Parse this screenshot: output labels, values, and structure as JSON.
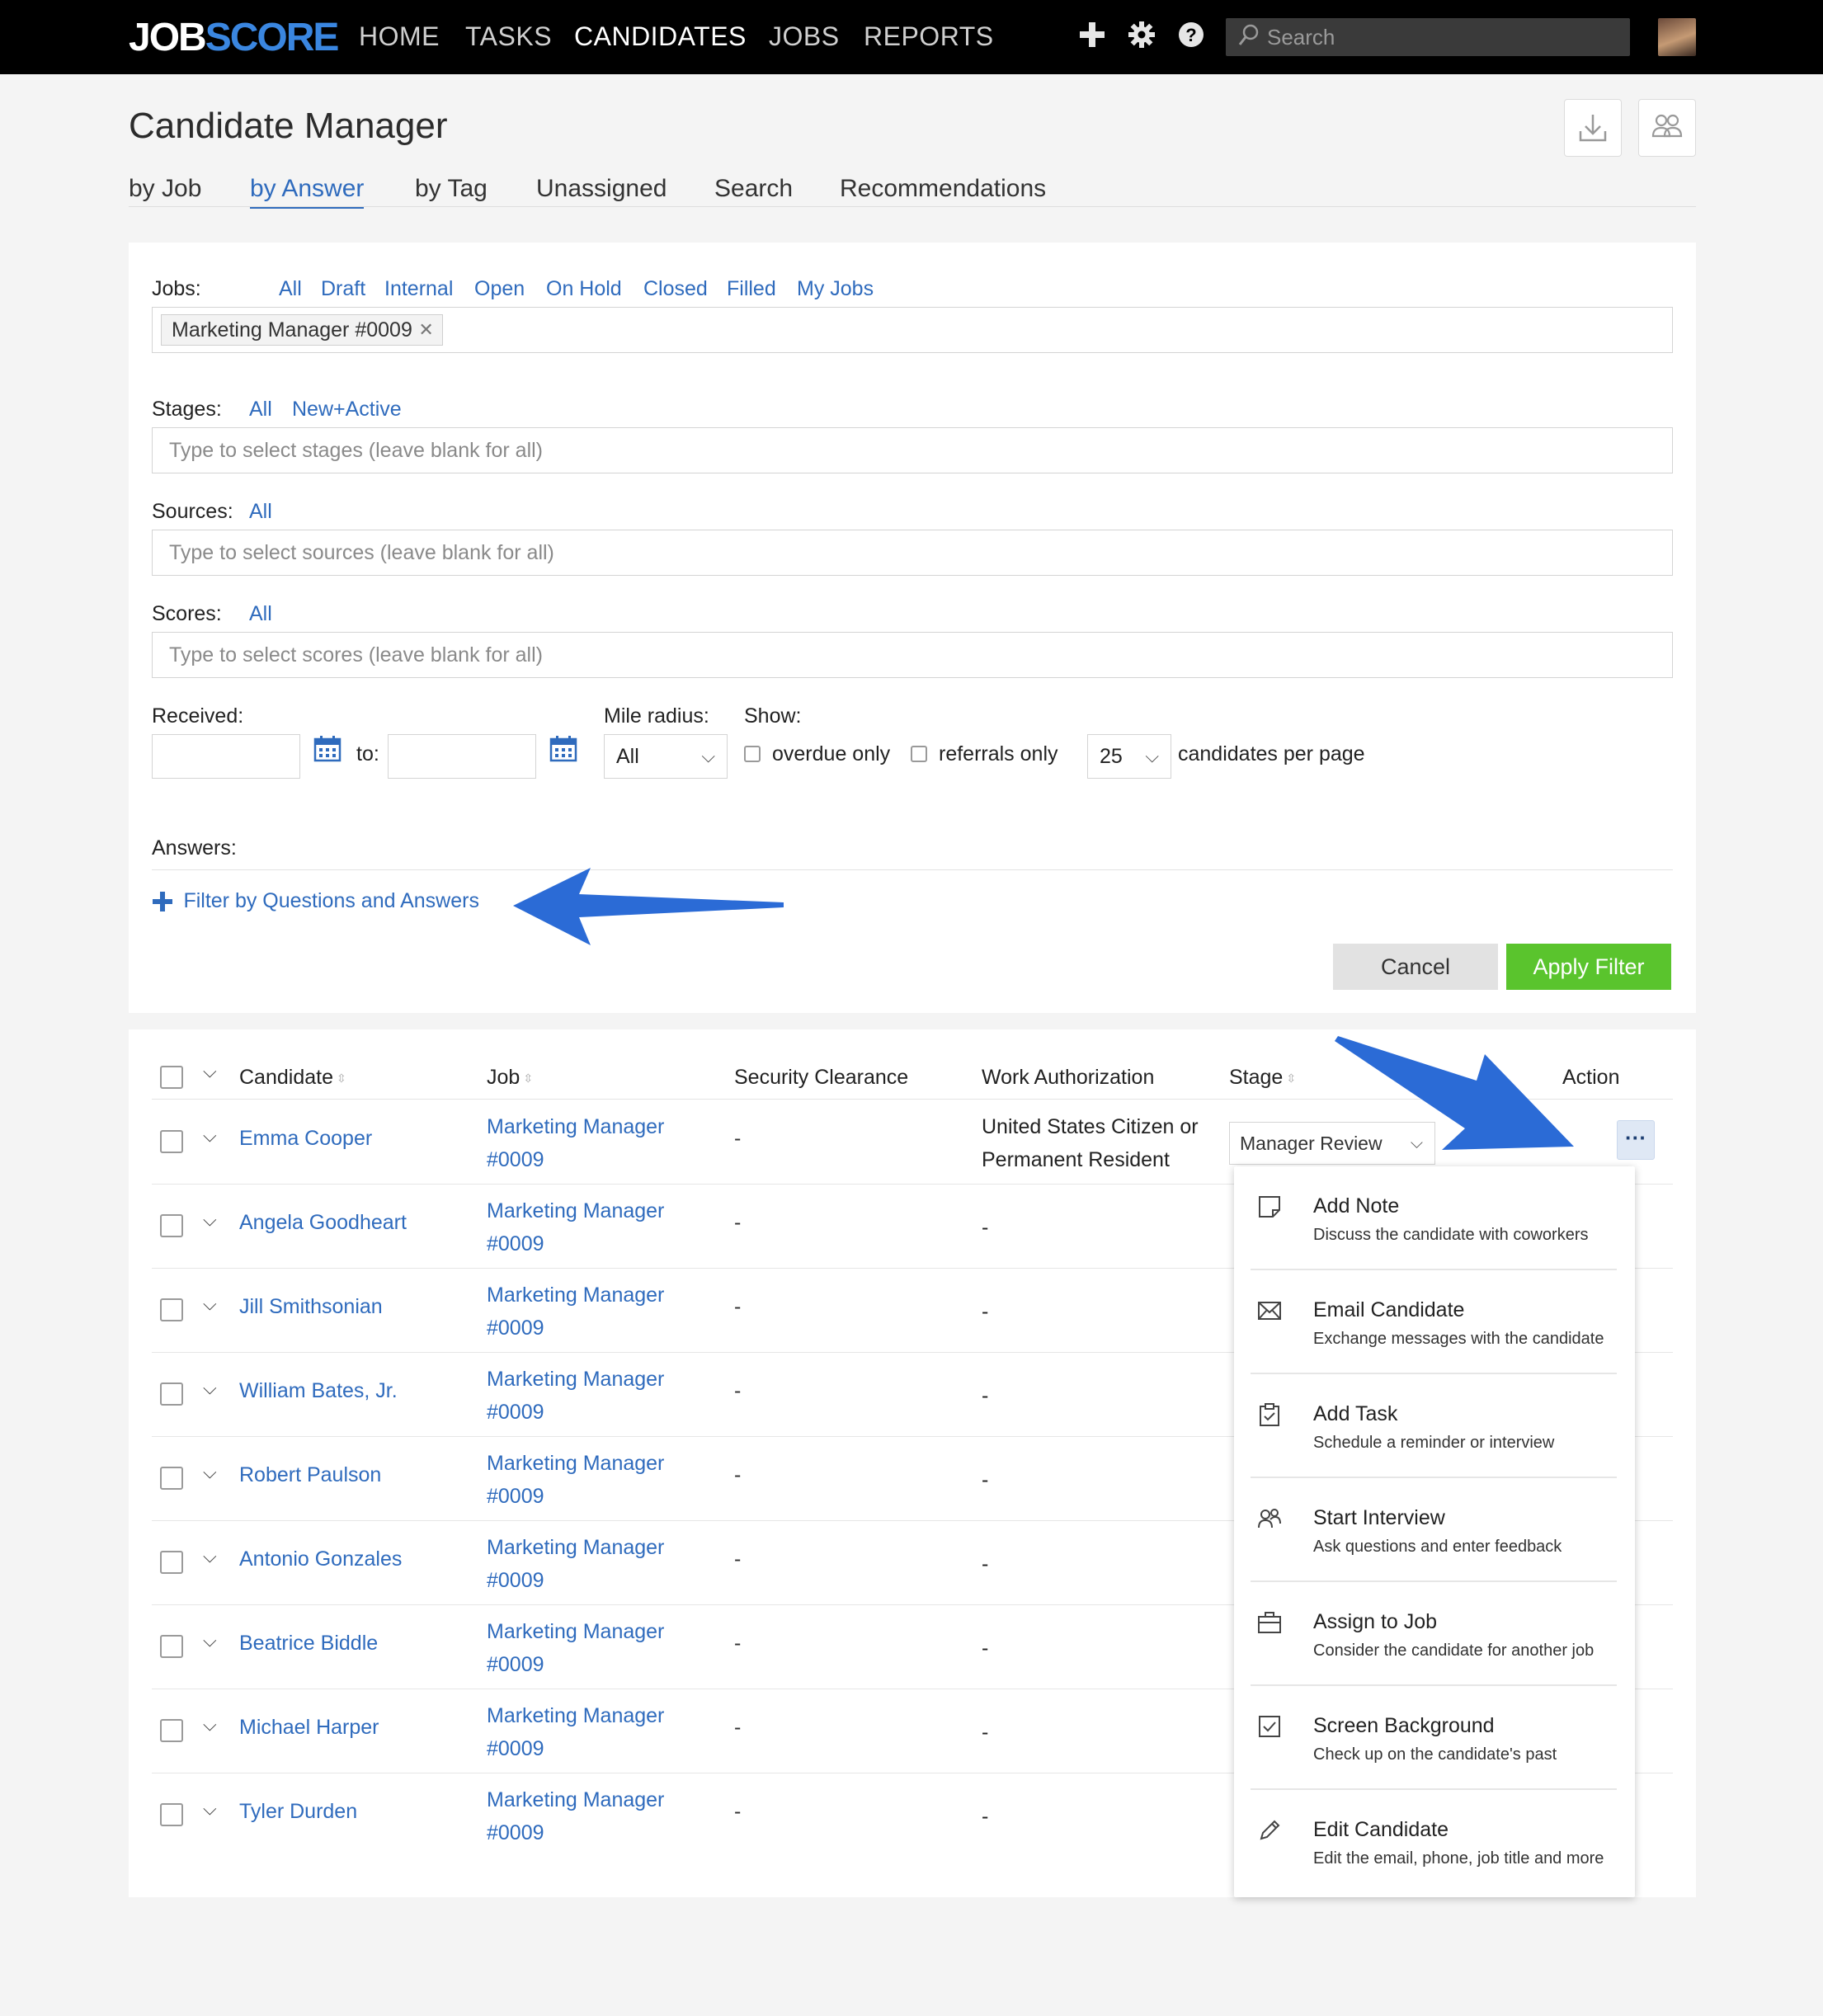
{
  "topnav": {
    "logo_part1": "JOB",
    "logo_part2": "SCORE",
    "links": [
      "HOME",
      "TASKS",
      "CANDIDATES",
      "JOBS",
      "REPORTS"
    ],
    "active": "CANDIDATES",
    "search_placeholder": "Search"
  },
  "header": {
    "title": "Candidate Manager",
    "tabs": [
      "by Job",
      "by Answer",
      "by Tag",
      "Unassigned",
      "Search",
      "Recommendations"
    ],
    "active_tab": "by Answer"
  },
  "filters": {
    "jobs_label": "Jobs:",
    "jobs_links": [
      "All",
      "Draft",
      "Internal",
      "Open",
      "On Hold",
      "Closed",
      "Filled",
      "My Jobs"
    ],
    "selected_job": "Marketing Manager #0009",
    "stages_label": "Stages:",
    "stages_links": [
      "All",
      "New+Active"
    ],
    "stages_placeholder": "Type to select stages (leave blank for all)",
    "sources_label": "Sources:",
    "sources_links": [
      "All"
    ],
    "sources_placeholder": "Type to select sources (leave blank for all)",
    "scores_label": "Scores:",
    "scores_links": [
      "All"
    ],
    "scores_placeholder": "Type to select scores (leave blank for all)",
    "received_label": "Received:",
    "to_label": "to:",
    "radius_label": "Mile radius:",
    "radius_value": "All",
    "show_label": "Show:",
    "overdue_label": "overdue only",
    "referrals_label": "referrals only",
    "per_page_value": "25",
    "per_page_label": "candidates per page",
    "answers_label": "Answers:",
    "filter_qa_label": "Filter by Questions and Answers",
    "cancel_label": "Cancel",
    "apply_label": "Apply Filter"
  },
  "table": {
    "headers": {
      "candidate": "Candidate",
      "job": "Job",
      "security": "Security Clearance",
      "work_auth": "Work Authorization",
      "stage": "Stage",
      "action": "Action"
    },
    "rows": [
      {
        "name": "Emma Cooper",
        "job1": "Marketing Manager",
        "job2": "#0009",
        "security": "-",
        "auth1": "United States Citizen or",
        "auth2": "Permanent Resident",
        "stage": "Manager Review"
      },
      {
        "name": "Angela Goodheart",
        "job1": "Marketing Manager",
        "job2": "#0009",
        "security": "-",
        "auth1": "-",
        "auth2": ""
      },
      {
        "name": "Jill Smithsonian",
        "job1": "Marketing Manager",
        "job2": "#0009",
        "security": "-",
        "auth1": "-",
        "auth2": ""
      },
      {
        "name": "William Bates, Jr.",
        "job1": "Marketing Manager",
        "job2": "#0009",
        "security": "-",
        "auth1": "-",
        "auth2": ""
      },
      {
        "name": "Robert Paulson",
        "job1": "Marketing Manager",
        "job2": "#0009",
        "security": "-",
        "auth1": "-",
        "auth2": ""
      },
      {
        "name": "Antonio Gonzales",
        "job1": "Marketing Manager",
        "job2": "#0009",
        "security": "-",
        "auth1": "-",
        "auth2": ""
      },
      {
        "name": "Beatrice Biddle",
        "job1": "Marketing Manager",
        "job2": "#0009",
        "security": "-",
        "auth1": "-",
        "auth2": ""
      },
      {
        "name": "Michael Harper",
        "job1": "Marketing Manager",
        "job2": "#0009",
        "security": "-",
        "auth1": "-",
        "auth2": ""
      },
      {
        "name": "Tyler Durden",
        "job1": "Marketing Manager",
        "job2": "#0009",
        "security": "-",
        "auth1": "-",
        "auth2": ""
      }
    ]
  },
  "action_menu": {
    "items": [
      {
        "title": "Add Note",
        "desc": "Discuss the candidate with coworkers",
        "icon": "note-icon"
      },
      {
        "title": "Email Candidate",
        "desc": "Exchange messages with the candidate",
        "icon": "envelope-icon"
      },
      {
        "title": "Add Task",
        "desc": "Schedule a reminder or interview",
        "icon": "clipboard-icon"
      },
      {
        "title": "Start Interview",
        "desc": "Ask questions and enter feedback",
        "icon": "interview-icon"
      },
      {
        "title": "Assign to Job",
        "desc": "Consider the candidate for another job",
        "icon": "briefcase-icon"
      },
      {
        "title": "Screen Background",
        "desc": "Check up on the candidate's past",
        "icon": "checkbox-icon"
      },
      {
        "title": "Edit Candidate",
        "desc": "Edit the email, phone, job title and more",
        "icon": "pencil-icon"
      }
    ]
  },
  "colors": {
    "accent": "#2f6bbd",
    "apply": "#5ac42d",
    "annotation_arrow": "#2b6bd6"
  }
}
